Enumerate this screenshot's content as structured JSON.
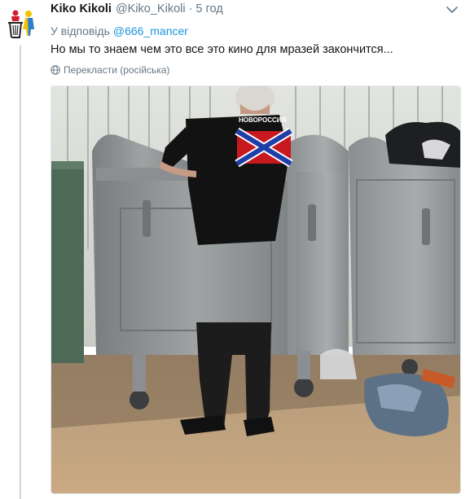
{
  "tweet": {
    "author_name": "Kiko Kikoli",
    "handle": "@Kiko_Kikoli",
    "separator": "·",
    "time": "5 год",
    "reply_prefix": "У відповідь",
    "reply_mention": "@666_mancer",
    "text": "Но мы то знаем чем это все это кино для мразей закончится...",
    "translate_label": "Перекласти (російська)",
    "shirt_text": "НОВОРОССИЯ"
  },
  "icons": {
    "avatar": "trash-bin-avatar-icon",
    "menu": "chevron-down-icon",
    "translate": "globe-icon"
  },
  "colors": {
    "name": "#14171a",
    "secondary": "#657786",
    "link": "#1b95e0",
    "thread_line": "#ccd6dd"
  }
}
